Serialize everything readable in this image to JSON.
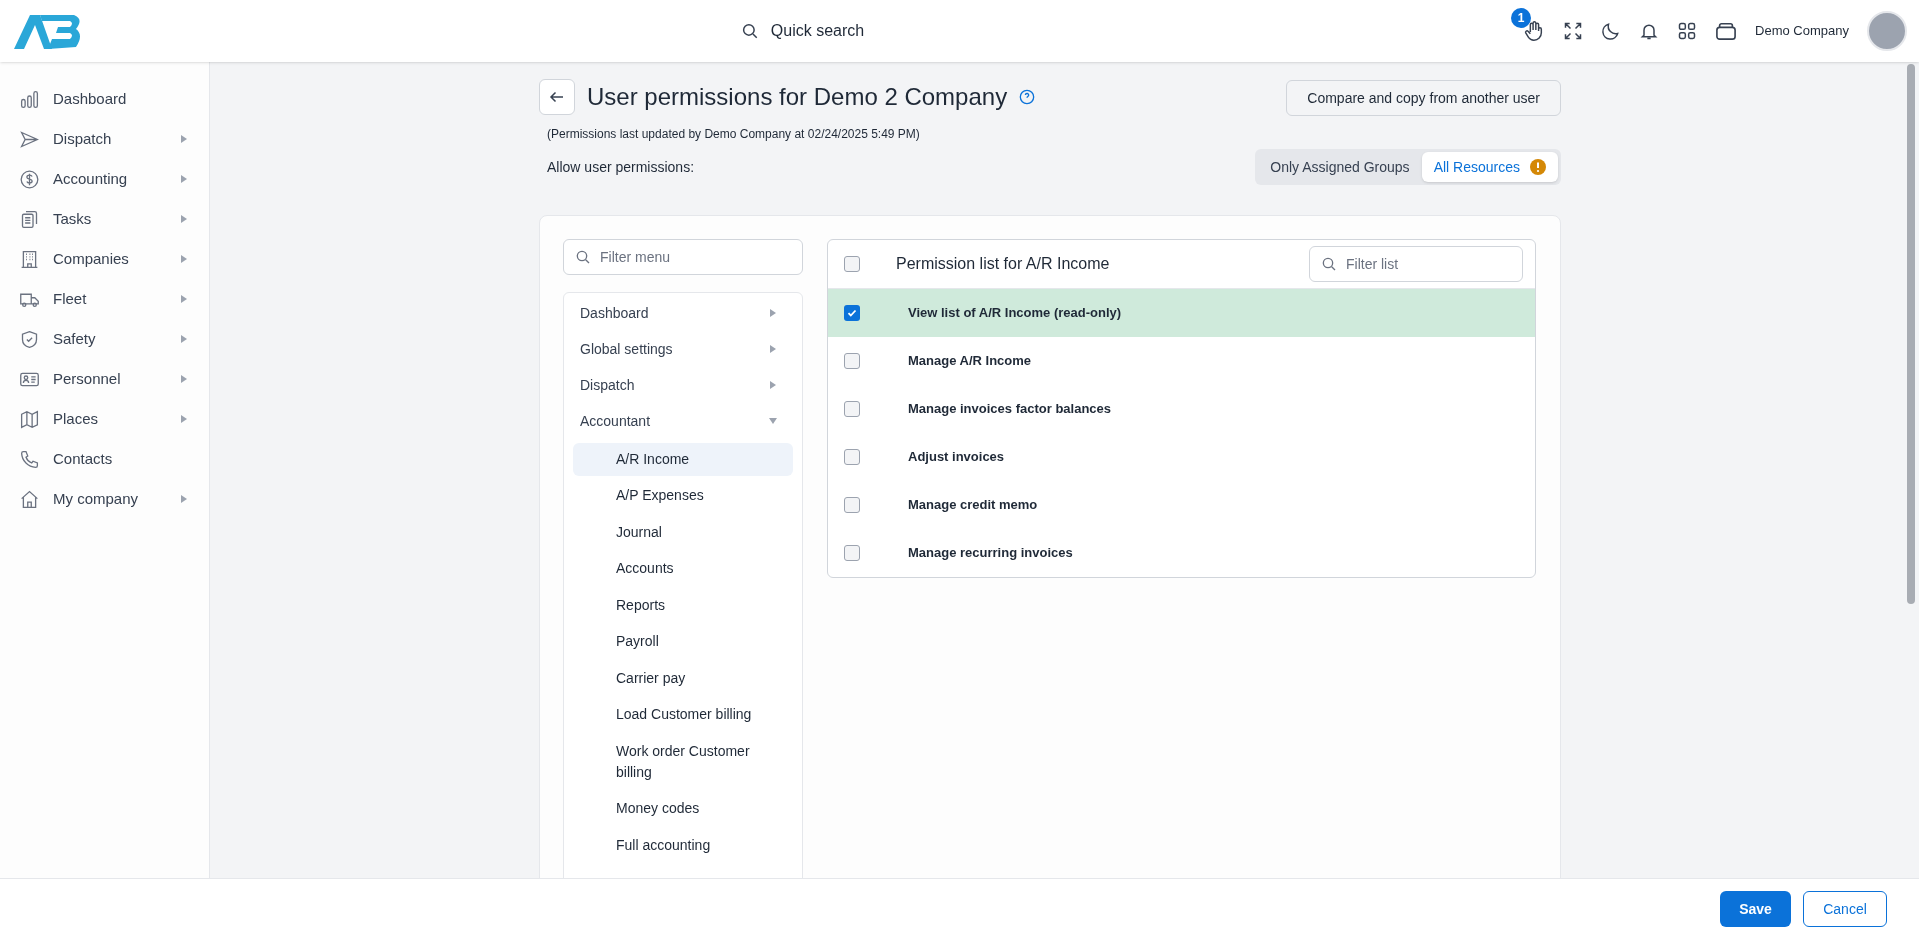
{
  "topbar": {
    "search_label": "Quick search",
    "notification_count": "1",
    "user_name": "Demo Company"
  },
  "sidebar": {
    "items": [
      {
        "label": "Dashboard",
        "has_submenu": false
      },
      {
        "label": "Dispatch",
        "has_submenu": true
      },
      {
        "label": "Accounting",
        "has_submenu": true
      },
      {
        "label": "Tasks",
        "has_submenu": true
      },
      {
        "label": "Companies",
        "has_submenu": true
      },
      {
        "label": "Fleet",
        "has_submenu": true
      },
      {
        "label": "Safety",
        "has_submenu": true
      },
      {
        "label": "Personnel",
        "has_submenu": true
      },
      {
        "label": "Places",
        "has_submenu": true
      },
      {
        "label": "Contacts",
        "has_submenu": false
      },
      {
        "label": "My company",
        "has_submenu": true
      }
    ]
  },
  "header": {
    "title": "User permissions for Demo 2 Company",
    "subtitle": "(Permissions last updated by Demo Company at 02/24/2025 5:49 PM)",
    "compare_button": "Compare and copy from another user",
    "allow_label": "Allow user permissions:",
    "modes": [
      {
        "label": "Only Assigned Groups",
        "selected": false,
        "warning": false
      },
      {
        "label": "All Resources",
        "selected": true,
        "warning": true
      }
    ]
  },
  "menu": {
    "placeholder": "Filter menu",
    "items": [
      {
        "label": "Dashboard",
        "expanded": false
      },
      {
        "label": "Global settings",
        "expanded": false
      },
      {
        "label": "Dispatch",
        "expanded": false
      },
      {
        "label": "Accountant",
        "expanded": true,
        "children": [
          {
            "label": "A/R Income",
            "selected": true
          },
          {
            "label": "A/P Expenses",
            "selected": false
          },
          {
            "label": "Journal",
            "selected": false
          },
          {
            "label": "Accounts",
            "selected": false
          },
          {
            "label": "Reports",
            "selected": false
          },
          {
            "label": "Payroll",
            "selected": false
          },
          {
            "label": "Carrier pay",
            "selected": false
          },
          {
            "label": "Load Customer billing",
            "selected": false
          },
          {
            "label": "Work order Customer billing",
            "selected": false
          },
          {
            "label": "Money codes",
            "selected": false
          },
          {
            "label": "Full accounting",
            "selected": false
          }
        ]
      }
    ]
  },
  "permissions": {
    "title": "Permission list for A/R Income",
    "all_checked": false,
    "placeholder": "Filter list",
    "rows": [
      {
        "label": "View list of A/R Income (read-only)",
        "checked": true
      },
      {
        "label": "Manage A/R Income",
        "checked": false
      },
      {
        "label": "Manage invoices factor balances",
        "checked": false
      },
      {
        "label": "Adjust invoices",
        "checked": false
      },
      {
        "label": "Manage credit memo",
        "checked": false
      },
      {
        "label": "Manage recurring invoices",
        "checked": false
      }
    ]
  },
  "footer": {
    "save": "Save",
    "cancel": "Cancel"
  }
}
